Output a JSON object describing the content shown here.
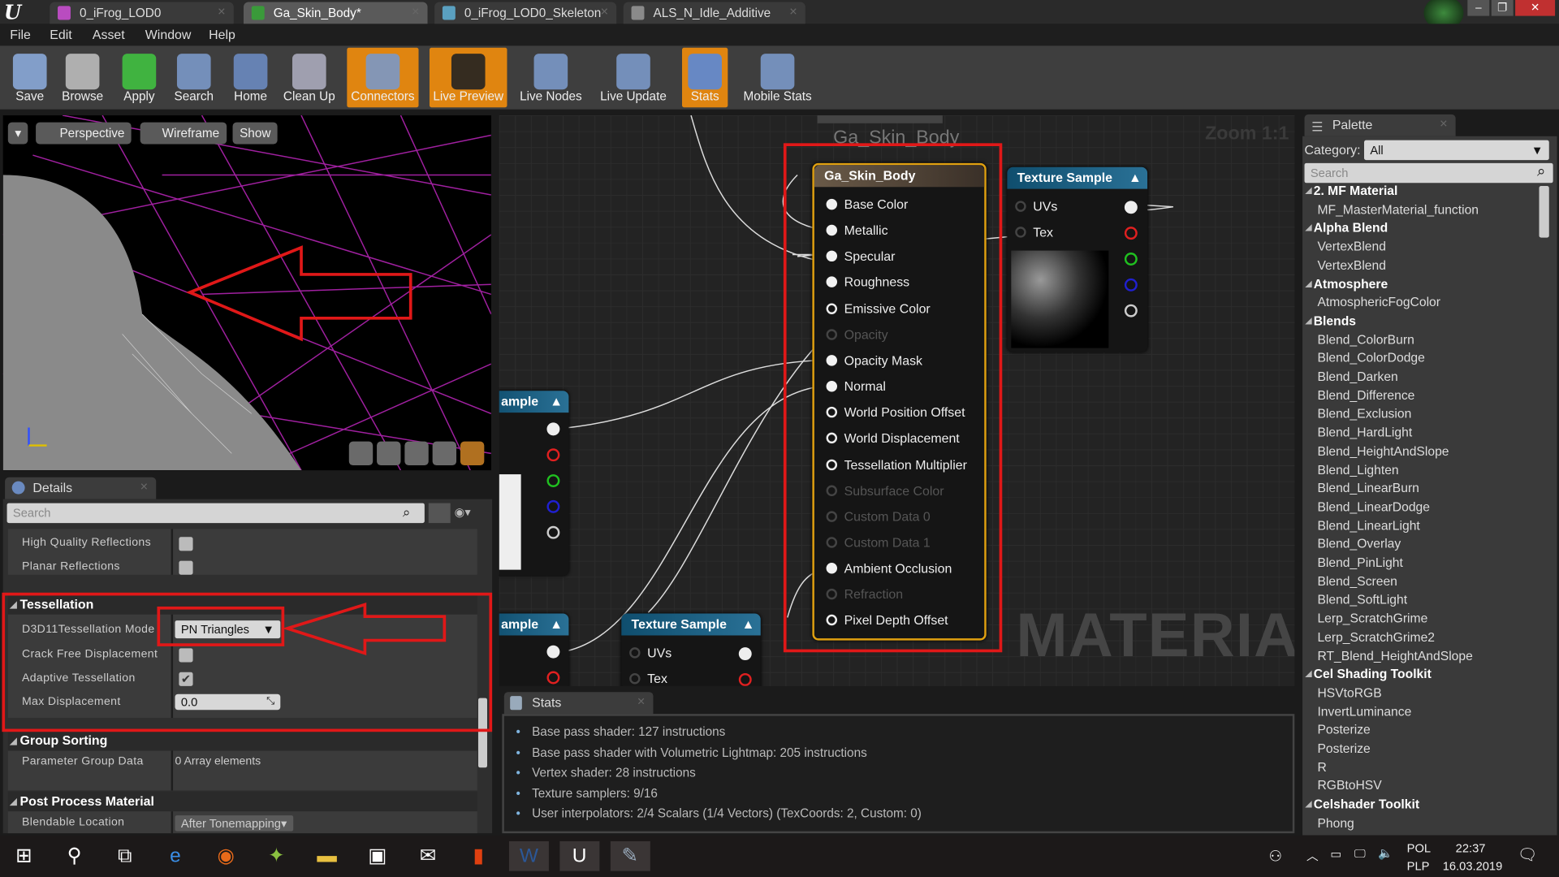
{
  "titlebar": {
    "tabs": [
      {
        "label": "0_iFrog_LOD0",
        "icon": "skeletal-mesh-icon",
        "color": "#b94cc0"
      },
      {
        "label": "Ga_Skin_Body*",
        "icon": "material-icon",
        "color": "#3a9a3a",
        "active": true
      },
      {
        "label": "0_iFrog_LOD0_Skeleton",
        "icon": "skeleton-icon",
        "color": "#5aa0c0"
      },
      {
        "label": "ALS_N_Idle_Additive",
        "icon": "animation-icon",
        "color": "#8a8a8a"
      }
    ],
    "logo": "U"
  },
  "menu": [
    "File",
    "Edit",
    "Asset",
    "Window",
    "Help"
  ],
  "toolbar": [
    {
      "label": "Save",
      "icon": "save-icon"
    },
    {
      "label": "Browse",
      "icon": "browse-icon"
    },
    {
      "label": "Apply",
      "icon": "apply-check-icon"
    },
    {
      "label": "Search",
      "icon": "binoculars-icon"
    },
    {
      "label": "Home",
      "icon": "home-icon"
    },
    {
      "label": "Clean Up",
      "icon": "clean-up-icon"
    },
    {
      "label": "Connectors",
      "icon": "connectors-icon",
      "active": true
    },
    {
      "label": "Live Preview",
      "icon": "live-preview-icon",
      "active": true
    },
    {
      "label": "Live Nodes",
      "icon": "live-nodes-icon"
    },
    {
      "label": "Live Update",
      "icon": "live-update-icon"
    },
    {
      "label": "Stats",
      "icon": "stats-icon",
      "active": true
    },
    {
      "label": "Mobile Stats",
      "icon": "mobile-stats-icon"
    }
  ],
  "accent": "#e08510",
  "viewport": {
    "perspective": "Perspective",
    "wireframe": "Wireframe",
    "show": "Show"
  },
  "details": {
    "tab": "Details",
    "search_placeholder": "Search",
    "high_quality_reflections": {
      "label": "High Quality Reflections",
      "checked": false
    },
    "planar_reflections": {
      "label": "Planar Reflections",
      "checked": false
    },
    "tessellation_header": "Tessellation",
    "tess_mode": {
      "label": "D3D11Tessellation Mode",
      "value": "PN Triangles"
    },
    "crack_free": {
      "label": "Crack Free Displacement",
      "checked": false
    },
    "adaptive": {
      "label": "Adaptive Tessellation",
      "checked": true
    },
    "max_disp": {
      "label": "Max Displacement",
      "value": "0.0"
    },
    "group_sorting_header": "Group Sorting",
    "param_group": {
      "label": "Parameter Group Data",
      "value": "0 Array elements"
    },
    "post_process_header": "Post Process Material",
    "blendable": {
      "label": "Blendable Location",
      "value": "After Tonemapping"
    }
  },
  "graph": {
    "watermark": "MATERIAL",
    "zoom": "Zoom 1:1",
    "comment": "Ga_Skin_Body",
    "material_node": {
      "title": "Ga_Skin_Body",
      "pins": [
        {
          "label": "Base Color",
          "state": "connected"
        },
        {
          "label": "Metallic",
          "state": "connected"
        },
        {
          "label": "Specular",
          "state": "connected"
        },
        {
          "label": "Roughness",
          "state": "connected"
        },
        {
          "label": "Emissive Color",
          "state": "open"
        },
        {
          "label": "Opacity",
          "state": "disabled"
        },
        {
          "label": "Opacity Mask",
          "state": "connected"
        },
        {
          "label": "Normal",
          "state": "connected"
        },
        {
          "label": "World Position Offset",
          "state": "open"
        },
        {
          "label": "World Displacement",
          "state": "open"
        },
        {
          "label": "Tessellation Multiplier",
          "state": "open"
        },
        {
          "label": "Subsurface Color",
          "state": "disabled"
        },
        {
          "label": "Custom Data 0",
          "state": "disabled"
        },
        {
          "label": "Custom Data 1",
          "state": "disabled"
        },
        {
          "label": "Ambient Occlusion",
          "state": "connected"
        },
        {
          "label": "Refraction",
          "state": "disabled"
        },
        {
          "label": "Pixel Depth Offset",
          "state": "open"
        }
      ]
    },
    "texture_sample": {
      "title": "Texture Sample",
      "inputs": [
        "UVs",
        "Tex"
      ]
    },
    "partial_node_label": "ample"
  },
  "stats": {
    "tab": "Stats",
    "lines": [
      "Base pass shader: 127 instructions",
      "Base pass shader with Volumetric Lightmap: 205 instructions",
      "Vertex shader: 28 instructions",
      "Texture samplers: 9/16",
      "User interpolators: 2/4 Scalars (1/4 Vectors) (TexCoords: 2, Custom: 0)"
    ]
  },
  "palette": {
    "tab": "Palette",
    "category_label": "Category:",
    "category_value": "All",
    "search_placeholder": "Search",
    "items": [
      {
        "label": "2. MF Material",
        "cat": true
      },
      {
        "label": "MF_MasterMaterial_function"
      },
      {
        "label": "Alpha Blend",
        "cat": true
      },
      {
        "label": "VertexBlend"
      },
      {
        "label": "VertexBlend"
      },
      {
        "label": "Atmosphere",
        "cat": true
      },
      {
        "label": "AtmosphericFogColor"
      },
      {
        "label": "Blends",
        "cat": true
      },
      {
        "label": "Blend_ColorBurn"
      },
      {
        "label": "Blend_ColorDodge"
      },
      {
        "label": "Blend_Darken"
      },
      {
        "label": "Blend_Difference"
      },
      {
        "label": "Blend_Exclusion"
      },
      {
        "label": "Blend_HardLight"
      },
      {
        "label": "Blend_HeightAndSlope"
      },
      {
        "label": "Blend_Lighten"
      },
      {
        "label": "Blend_LinearBurn"
      },
      {
        "label": "Blend_LinearDodge"
      },
      {
        "label": "Blend_LinearLight"
      },
      {
        "label": "Blend_Overlay"
      },
      {
        "label": "Blend_PinLight"
      },
      {
        "label": "Blend_Screen"
      },
      {
        "label": "Blend_SoftLight"
      },
      {
        "label": "Lerp_ScratchGrime"
      },
      {
        "label": "Lerp_ScratchGrime2"
      },
      {
        "label": "RT_Blend_HeightAndSlope"
      },
      {
        "label": "Cel Shading Toolkit",
        "cat": true
      },
      {
        "label": "HSVtoRGB"
      },
      {
        "label": "InvertLuminance"
      },
      {
        "label": "Posterize"
      },
      {
        "label": "Posterize"
      },
      {
        "label": "R"
      },
      {
        "label": "RGBtoHSV"
      },
      {
        "label": "Celshader Toolkit",
        "cat": true
      },
      {
        "label": "Phong"
      }
    ]
  },
  "taskbar": {
    "apps": [
      "start-icon",
      "search-icon",
      "task-view-icon",
      "edge-icon",
      "firefox-icon",
      "app-icon",
      "file-explorer-icon",
      "store-icon",
      "mail-icon",
      "office-icon",
      "word-icon",
      "unreal-engine-icon",
      "paint-icon"
    ],
    "lang_top": "POL",
    "lang_bottom": "PLP",
    "time": "22:37",
    "date": "16.03.2019"
  }
}
